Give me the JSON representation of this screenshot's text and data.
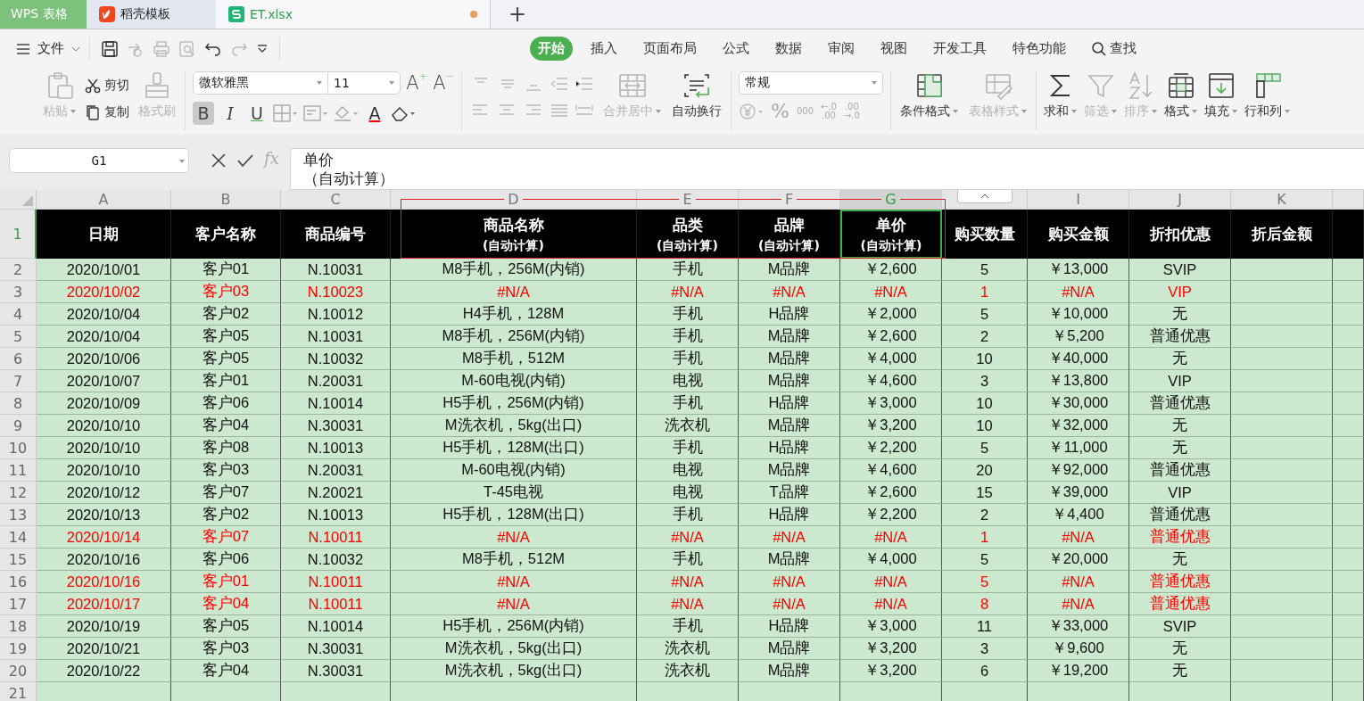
{
  "tabs": [
    {
      "label": "WPS 表格",
      "kind": "home",
      "selected": false
    },
    {
      "label": "稻壳模板",
      "kind": "template",
      "selected": false
    },
    {
      "label": "ET.xlsx",
      "kind": "sheet",
      "selected": true,
      "modified": true
    }
  ],
  "new_tab": "+",
  "menu": {
    "file": "文件",
    "tabs": [
      {
        "label": "开始",
        "selected": true
      },
      {
        "label": "插入",
        "selected": false
      },
      {
        "label": "页面布局",
        "selected": false
      },
      {
        "label": "公式",
        "selected": false
      },
      {
        "label": "数据",
        "selected": false
      },
      {
        "label": "审阅",
        "selected": false
      },
      {
        "label": "视图",
        "selected": false
      },
      {
        "label": "开发工具",
        "selected": false
      },
      {
        "label": "特色功能",
        "selected": false
      }
    ],
    "search": "查找"
  },
  "ribbon": {
    "clipboard": [
      {
        "label": "粘贴",
        "disabled": true,
        "dropdown": true
      },
      {
        "label": "剪切",
        "disabled": false,
        "dropdown": false
      },
      {
        "label": "复制",
        "disabled": false,
        "dropdown": false
      },
      {
        "label": "格式刷",
        "disabled": true,
        "dropdown": false
      }
    ],
    "font": {
      "name": "微软雅黑",
      "size": "11",
      "grow": "A",
      "grow_sign": "+",
      "shrink": "A",
      "shrink_sign": "−",
      "bold": "B",
      "bold_on": true,
      "italic": "I",
      "underline": "U",
      "color_letter": "A"
    },
    "alignment": [
      {
        "label": "合并居中",
        "disabled": true,
        "dropdown": true
      },
      {
        "label": "自动换行",
        "disabled": false,
        "dropdown": false
      }
    ],
    "number": {
      "format": "常规",
      "percent": "%",
      "thousands": "000",
      "decimals_up": [
        "←.0",
        ".00"
      ],
      "decimals_down": [
        ".00",
        "→.0"
      ]
    },
    "styles": [
      {
        "label": "条件格式",
        "disabled": false,
        "dropdown": true
      },
      {
        "label": "表格样式",
        "disabled": true,
        "dropdown": true
      }
    ],
    "editing": [
      {
        "label": "求和",
        "disabled": false,
        "dropdown": true
      },
      {
        "label": "筛选",
        "disabled": true,
        "dropdown": true
      },
      {
        "label": "排序",
        "disabled": true,
        "dropdown": true
      },
      {
        "label": "格式",
        "disabled": false,
        "dropdown": true
      },
      {
        "label": "填充",
        "disabled": false,
        "dropdown": true
      },
      {
        "label": "行和列",
        "disabled": false,
        "dropdown": true
      }
    ]
  },
  "formula_bar": {
    "cell_ref": "G1",
    "fx": "fx",
    "value_lines": [
      "单价",
      "（自动计算）"
    ]
  },
  "column_headers": [
    {
      "kind": "letter",
      "letter": "A",
      "selected": false
    },
    {
      "kind": "letter",
      "letter": "B",
      "selected": false
    },
    {
      "kind": "letter",
      "letter": "C",
      "selected": false
    },
    {
      "kind": "letter",
      "letter": "D",
      "selected": false
    },
    {
      "kind": "letter",
      "letter": "E",
      "selected": false
    },
    {
      "kind": "letter",
      "letter": "F",
      "selected": false
    },
    {
      "kind": "letter",
      "letter": "G",
      "selected": true
    },
    {
      "kind": "collapse"
    },
    {
      "kind": "letter",
      "letter": "I",
      "selected": false
    },
    {
      "kind": "letter",
      "letter": "J",
      "selected": false
    },
    {
      "kind": "letter",
      "letter": "K",
      "selected": false
    }
  ],
  "header_row": {
    "number": "1",
    "cells": [
      {
        "title": "日期",
        "selected": false
      },
      {
        "title": "客户名称",
        "selected": false
      },
      {
        "title": "商品编号",
        "selected": false
      },
      {
        "title": "商品名称",
        "note": "(自动计算)",
        "selected": false
      },
      {
        "title": "品类",
        "note": "(自动计算)",
        "selected": false
      },
      {
        "title": "品牌",
        "note": "(自动计算)",
        "selected": false
      },
      {
        "title": "单价",
        "note": "(自动计算)",
        "selected": true
      },
      {
        "title": "购买数量",
        "selected": false
      },
      {
        "title": "购买金额",
        "selected": false
      },
      {
        "title": "折扣优惠",
        "selected": false
      },
      {
        "title": "折后金额",
        "selected": false
      }
    ]
  },
  "rows": [
    {
      "number": "2",
      "error": false,
      "cells": [
        "2020/10/01",
        "客户01",
        "N.10031",
        "M8手机，256M(内销)",
        "手机",
        "M品牌",
        "￥2,600",
        "5",
        "￥13,000",
        "SVIP"
      ]
    },
    {
      "number": "3",
      "error": true,
      "cells": [
        "2020/10/02",
        "客户03",
        "N.10023",
        "#N/A",
        "#N/A",
        "#N/A",
        "#N/A",
        "1",
        "#N/A",
        "VIP"
      ]
    },
    {
      "number": "4",
      "error": false,
      "cells": [
        "2020/10/04",
        "客户02",
        "N.10012",
        "H4手机，128M",
        "手机",
        "H品牌",
        "￥2,000",
        "5",
        "￥10,000",
        "无"
      ]
    },
    {
      "number": "5",
      "error": false,
      "cells": [
        "2020/10/04",
        "客户05",
        "N.10031",
        "M8手机，256M(内销)",
        "手机",
        "M品牌",
        "￥2,600",
        "2",
        "￥5,200",
        "普通优惠"
      ]
    },
    {
      "number": "6",
      "error": false,
      "cells": [
        "2020/10/06",
        "客户05",
        "N.10032",
        "M8手机，512M",
        "手机",
        "M品牌",
        "￥4,000",
        "10",
        "￥40,000",
        "无"
      ]
    },
    {
      "number": "7",
      "error": false,
      "cells": [
        "2020/10/07",
        "客户01",
        "N.20031",
        "M-60电视(内销)",
        "电视",
        "M品牌",
        "￥4,600",
        "3",
        "￥13,800",
        "VIP"
      ]
    },
    {
      "number": "8",
      "error": false,
      "cells": [
        "2020/10/09",
        "客户06",
        "N.10014",
        "H5手机，256M(内销)",
        "手机",
        "H品牌",
        "￥3,000",
        "10",
        "￥30,000",
        "普通优惠"
      ]
    },
    {
      "number": "9",
      "error": false,
      "cells": [
        "2020/10/10",
        "客户04",
        "N.30031",
        "M洗衣机，5kg(出口)",
        "洗衣机",
        "M品牌",
        "￥3,200",
        "10",
        "￥32,000",
        "无"
      ]
    },
    {
      "number": "10",
      "error": false,
      "cells": [
        "2020/10/10",
        "客户08",
        "N.10013",
        "H5手机，128M(出口)",
        "手机",
        "H品牌",
        "￥2,200",
        "5",
        "￥11,000",
        "无"
      ]
    },
    {
      "number": "11",
      "error": false,
      "cells": [
        "2020/10/10",
        "客户03",
        "N.20031",
        "M-60电视(内销)",
        "电视",
        "M品牌",
        "￥4,600",
        "20",
        "￥92,000",
        "普通优惠"
      ]
    },
    {
      "number": "12",
      "error": false,
      "cells": [
        "2020/10/12",
        "客户07",
        "N.20021",
        "T-45电视",
        "电视",
        "T品牌",
        "￥2,600",
        "15",
        "￥39,000",
        "VIP"
      ]
    },
    {
      "number": "13",
      "error": false,
      "cells": [
        "2020/10/13",
        "客户02",
        "N.10013",
        "H5手机，128M(出口)",
        "手机",
        "H品牌",
        "￥2,200",
        "2",
        "￥4,400",
        "普通优惠"
      ]
    },
    {
      "number": "14",
      "error": true,
      "cells": [
        "2020/10/14",
        "客户07",
        "N.10011",
        "#N/A",
        "#N/A",
        "#N/A",
        "#N/A",
        "1",
        "#N/A",
        "普通优惠"
      ]
    },
    {
      "number": "15",
      "error": false,
      "cells": [
        "2020/10/16",
        "客户06",
        "N.10032",
        "M8手机，512M",
        "手机",
        "M品牌",
        "￥4,000",
        "5",
        "￥20,000",
        "无"
      ]
    },
    {
      "number": "16",
      "error": true,
      "cells": [
        "2020/10/16",
        "客户01",
        "N.10011",
        "#N/A",
        "#N/A",
        "#N/A",
        "#N/A",
        "5",
        "#N/A",
        "普通优惠"
      ]
    },
    {
      "number": "17",
      "error": true,
      "cells": [
        "2020/10/17",
        "客户04",
        "N.10011",
        "#N/A",
        "#N/A",
        "#N/A",
        "#N/A",
        "8",
        "#N/A",
        "普通优惠"
      ]
    },
    {
      "number": "18",
      "error": false,
      "cells": [
        "2020/10/19",
        "客户05",
        "N.10014",
        "H5手机，256M(内销)",
        "手机",
        "H品牌",
        "￥3,000",
        "11",
        "￥33,000",
        "SVIP"
      ]
    },
    {
      "number": "19",
      "error": false,
      "cells": [
        "2020/10/21",
        "客户03",
        "N.30031",
        "M洗衣机，5kg(出口)",
        "洗衣机",
        "M品牌",
        "￥3,200",
        "3",
        "￥9,600",
        "无"
      ]
    },
    {
      "number": "20",
      "error": false,
      "cells": [
        "2020/10/22",
        "客户04",
        "N.30031",
        "M洗衣机，5kg(出口)",
        "洗衣机",
        "M品牌",
        "￥3,200",
        "6",
        "￥19,200",
        "无"
      ]
    },
    {
      "number": "21",
      "cells": []
    }
  ]
}
